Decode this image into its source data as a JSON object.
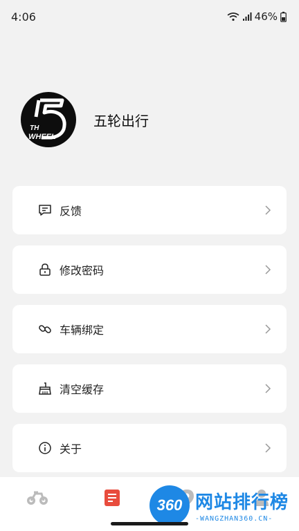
{
  "status_bar": {
    "time": "4:06",
    "battery": "46%"
  },
  "profile": {
    "logo_text_top": "TH",
    "logo_text_bottom": "WHEEL",
    "app_name": "五轮出行"
  },
  "menu": {
    "items": [
      {
        "label": "反馈",
        "icon": "feedback-icon"
      },
      {
        "label": "修改密码",
        "icon": "lock-icon"
      },
      {
        "label": "车辆绑定",
        "icon": "link-icon"
      },
      {
        "label": "清空缓存",
        "icon": "broom-icon"
      },
      {
        "label": "关于",
        "icon": "info-icon"
      }
    ]
  },
  "tabbar": {
    "tabs": [
      {
        "icon": "bicycle-icon",
        "active": false
      },
      {
        "icon": "document-icon",
        "active": true
      },
      {
        "icon": "map-pin-icon",
        "active": false
      },
      {
        "icon": "user-icon",
        "active": false
      }
    ],
    "accent_color": "#e84c3d",
    "inactive_color": "#bbbbbb"
  },
  "watermark": {
    "badge": "360",
    "title": "网站排行榜",
    "subtitle": "-WANGZHAN360.CN-"
  }
}
